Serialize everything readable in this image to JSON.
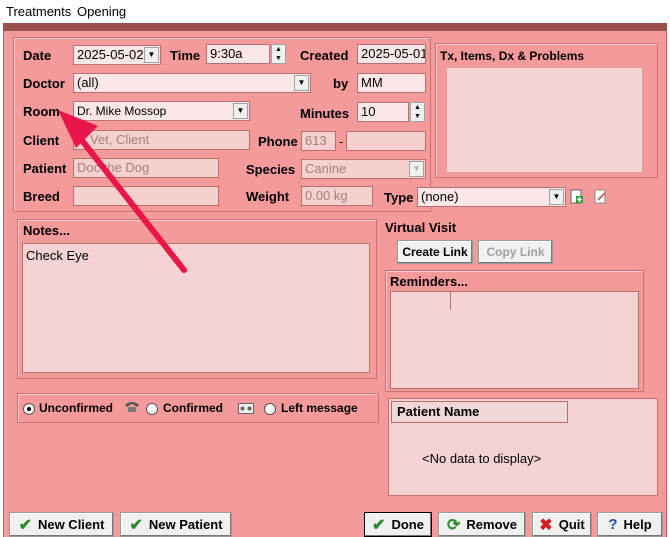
{
  "menu": {
    "treatments": "Treatments",
    "opening": "Opening"
  },
  "form": {
    "date_label": "Date",
    "date_value": "2025-05-02",
    "time_label": "Time",
    "time_value": "9:30a",
    "created_label": "Created",
    "created_value": "2025-05-01",
    "doctor_label": "Doctor",
    "doctor_value": "(all)",
    "by_label": "by",
    "by_value": "MM",
    "room_label": "Room",
    "room_value": "Dr. Mike Mossop",
    "minutes_label": "Minutes",
    "minutes_value": "10",
    "client_label": "Client",
    "client_value": "Vet, Client",
    "phone_label": "Phone",
    "phone_area": "613",
    "phone_sep": "-",
    "phone_number": "",
    "patient_label": "Patient",
    "patient_value": "Doc the Dog",
    "species_label": "Species",
    "species_value": "Canine",
    "breed_label": "Breed",
    "breed_value": "",
    "weight_label": "Weight",
    "weight_value": "0.00 kg",
    "type_label": "Type",
    "type_value": "(none)"
  },
  "tx_panel": {
    "title": "Tx, Items, Dx & Problems"
  },
  "notes": {
    "title": "Notes...",
    "text": "Check Eye"
  },
  "virtual_visit": {
    "title": "Virtual Visit",
    "create_link": "Create Link",
    "copy_link": "Copy Link"
  },
  "reminders": {
    "title": "Reminders..."
  },
  "status": {
    "unconfirmed": "Unconfirmed",
    "confirmed": "Confirmed",
    "left_message": "Left message",
    "selected": "unconfirmed"
  },
  "patient_grid": {
    "column": "Patient Name",
    "empty": "<No data to display>"
  },
  "buttons": {
    "new_client": "New Client",
    "new_patient": "New Patient",
    "done": "Done",
    "remove": "Remove",
    "quit": "Quit",
    "help": "Help"
  },
  "colors": {
    "dialog_bg": "#f49a9a",
    "annotation_arrow": "#e8174a"
  }
}
